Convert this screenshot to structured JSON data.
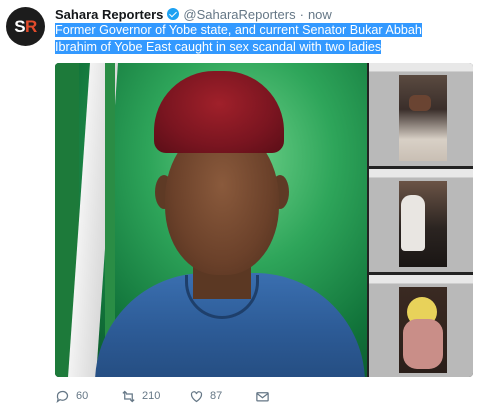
{
  "tweet": {
    "avatar_text_s": "S",
    "avatar_text_r": "R",
    "author_name": "Sahara Reporters",
    "handle": "@SaharaReporters",
    "separator": "·",
    "time": "now",
    "text": "Former Governor of Yobe state, and current Senator Bukar Abbah Ibrahim of Yobe East caught in sex scandal with two ladies",
    "selection_color": "#3399ff",
    "verified_color": "#1da1f2"
  },
  "actions": {
    "reply": {
      "icon": "reply-icon",
      "count": "60"
    },
    "retweet": {
      "icon": "retweet-icon",
      "count": "210"
    },
    "like": {
      "icon": "heart-icon",
      "count": "87"
    },
    "message": {
      "icon": "envelope-icon"
    }
  }
}
